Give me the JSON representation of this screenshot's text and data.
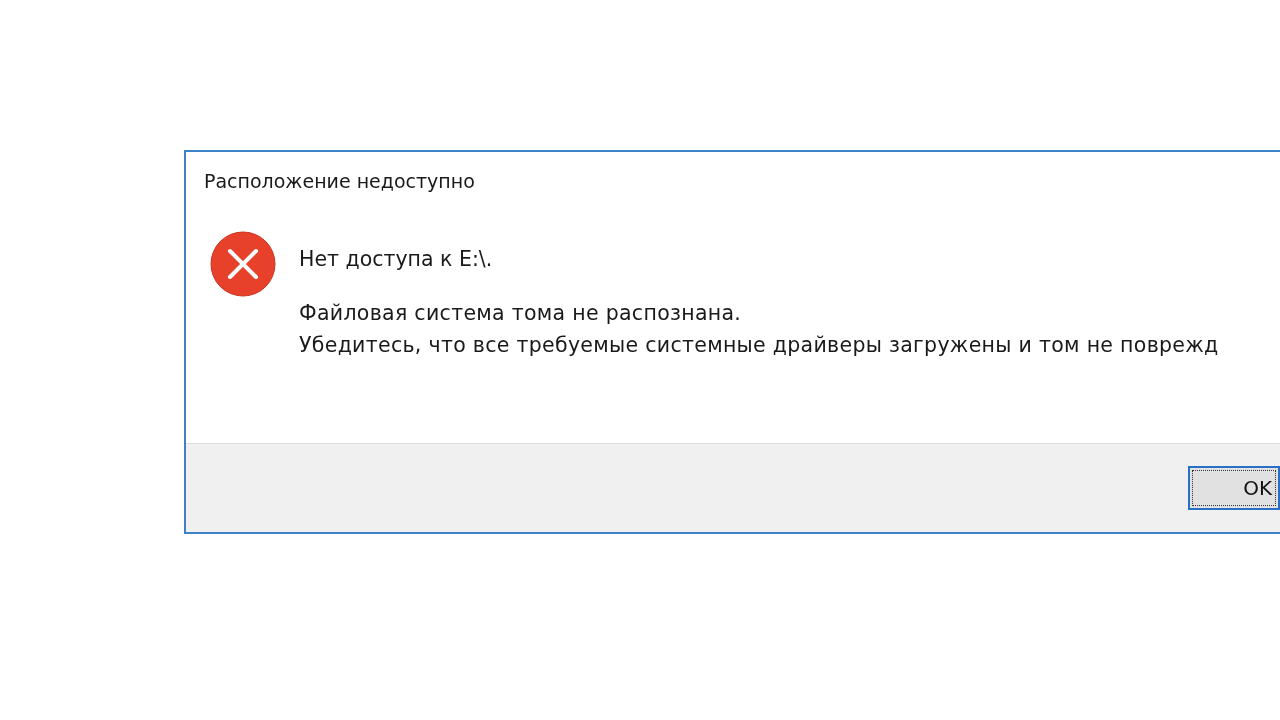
{
  "dialog": {
    "title": "Расположение недоступно",
    "heading": "Нет доступа к E:\\.",
    "message_lines": [
      "Файловая система тома не распознана.",
      "Убедитесь, что все требуемые системные драйверы загружены и том не поврежд"
    ],
    "buttons": [
      {
        "label": "OK",
        "focused": true
      }
    ]
  }
}
